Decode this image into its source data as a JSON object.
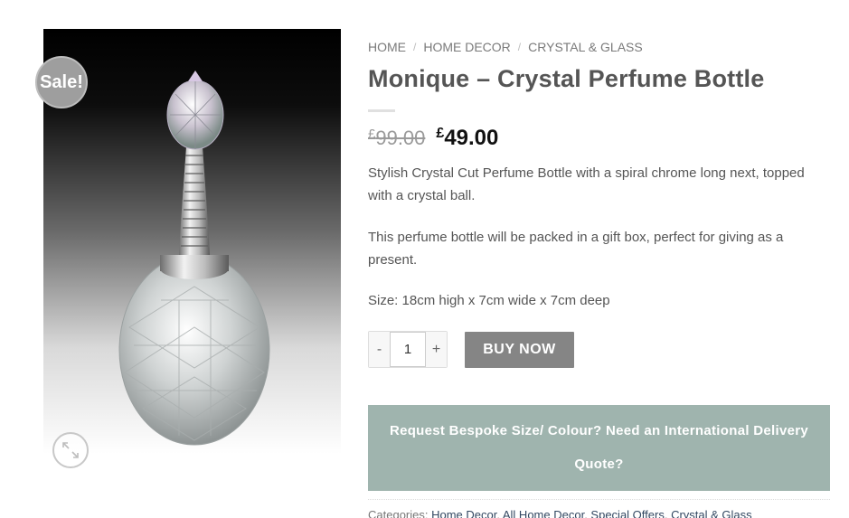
{
  "product_image": {
    "alt": "Monique Crystal Perfume Bottle"
  },
  "badge": {
    "label": "Sale!"
  },
  "breadcrumb": [
    "HOME",
    "HOME DECOR",
    "CRYSTAL & GLASS"
  ],
  "product": {
    "title": "Monique – Crystal Perfume Bottle",
    "currency": "£",
    "old_price": "99.00",
    "new_price": "49.00",
    "description": [
      "Stylish Crystal Cut Perfume Bottle with a spiral chrome long next, topped with a crystal ball.",
      "This perfume bottle will be packed in a gift box, perfect for giving as a present.",
      "Size: 18cm high x 7cm wide x 7cm deep"
    ]
  },
  "cart": {
    "minus": "-",
    "plus": "+",
    "quantity": "1",
    "buy_label": "BUY NOW"
  },
  "bespoke": {
    "line1": "Request Bespoke Size/ Colour? Need an International Delivery",
    "line2": "Quote?"
  },
  "meta": {
    "categories_label": "Categories:",
    "categories": [
      "Home Decor",
      "All Home Decor",
      "Special Offers",
      "Crystal & Glass"
    ]
  },
  "colors": {
    "bespoke_bg": "#9fb4ae",
    "buy_bg": "#858585",
    "badge_bg": "#9e9e9e"
  },
  "icons": {
    "zoom": "zoom-expand-icon"
  }
}
